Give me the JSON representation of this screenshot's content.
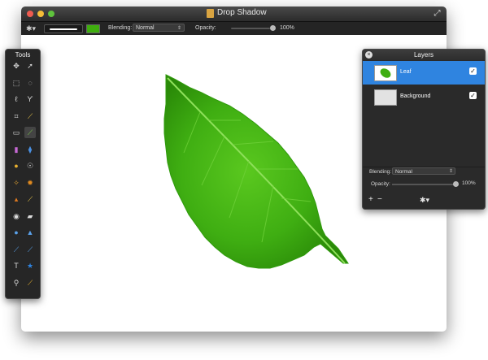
{
  "window": {
    "title": "Drop Shadow"
  },
  "options_bar": {
    "blending_label": "Blending:",
    "blending_value": "Normal",
    "opacity_label": "Opacity:",
    "opacity_value": "100%",
    "brush_color": "#3fae0e"
  },
  "tools_panel": {
    "title": "Tools",
    "tools": [
      {
        "name": "move-icon",
        "glyph": "✥"
      },
      {
        "name": "pointer-icon",
        "glyph": "➚"
      },
      {
        "name": "rect-select-icon",
        "glyph": "⬚"
      },
      {
        "name": "ellipse-select-icon",
        "glyph": "◌"
      },
      {
        "name": "lasso-icon",
        "glyph": "ℓ"
      },
      {
        "name": "magnetic-lasso-icon",
        "glyph": "ϒ"
      },
      {
        "name": "crop-icon",
        "glyph": "⌗"
      },
      {
        "name": "eyedropper-icon",
        "glyph": "⟋"
      },
      {
        "name": "eraser-icon",
        "glyph": "▭"
      },
      {
        "name": "brush-icon",
        "glyph": "⟋"
      },
      {
        "name": "gradient-icon",
        "glyph": "▮"
      },
      {
        "name": "paint-bucket-icon",
        "glyph": "⧫"
      },
      {
        "name": "smudge-icon",
        "glyph": "●"
      },
      {
        "name": "dodge-icon",
        "glyph": "☉"
      },
      {
        "name": "clone-stamp-icon",
        "glyph": "✧"
      },
      {
        "name": "burn-icon",
        "glyph": "✹"
      },
      {
        "name": "stamp-icon",
        "glyph": "▴"
      },
      {
        "name": "pencil-icon",
        "glyph": "⟋"
      },
      {
        "name": "red-eye-icon",
        "glyph": "◉"
      },
      {
        "name": "bandage-icon",
        "glyph": "▰"
      },
      {
        "name": "blur-icon",
        "glyph": "●"
      },
      {
        "name": "sharpen-icon",
        "glyph": "▲"
      },
      {
        "name": "pen-icon",
        "glyph": "⟋"
      },
      {
        "name": "pen-node-icon",
        "glyph": "⟋"
      },
      {
        "name": "text-icon",
        "glyph": "T"
      },
      {
        "name": "shape-icon",
        "glyph": "★"
      },
      {
        "name": "zoom-icon",
        "glyph": "⚲"
      },
      {
        "name": "color-picker-icon",
        "glyph": "⟋"
      }
    ]
  },
  "layers_panel": {
    "title": "Layers",
    "layers": [
      {
        "name": "Leaf",
        "visible": true,
        "selected": true
      },
      {
        "name": "Background",
        "visible": true,
        "selected": false
      }
    ],
    "blending_label": "Blending:",
    "blending_value": "Normal",
    "opacity_label": "Opacity:",
    "opacity_value": "100%",
    "add_label": "+",
    "remove_label": "−"
  }
}
